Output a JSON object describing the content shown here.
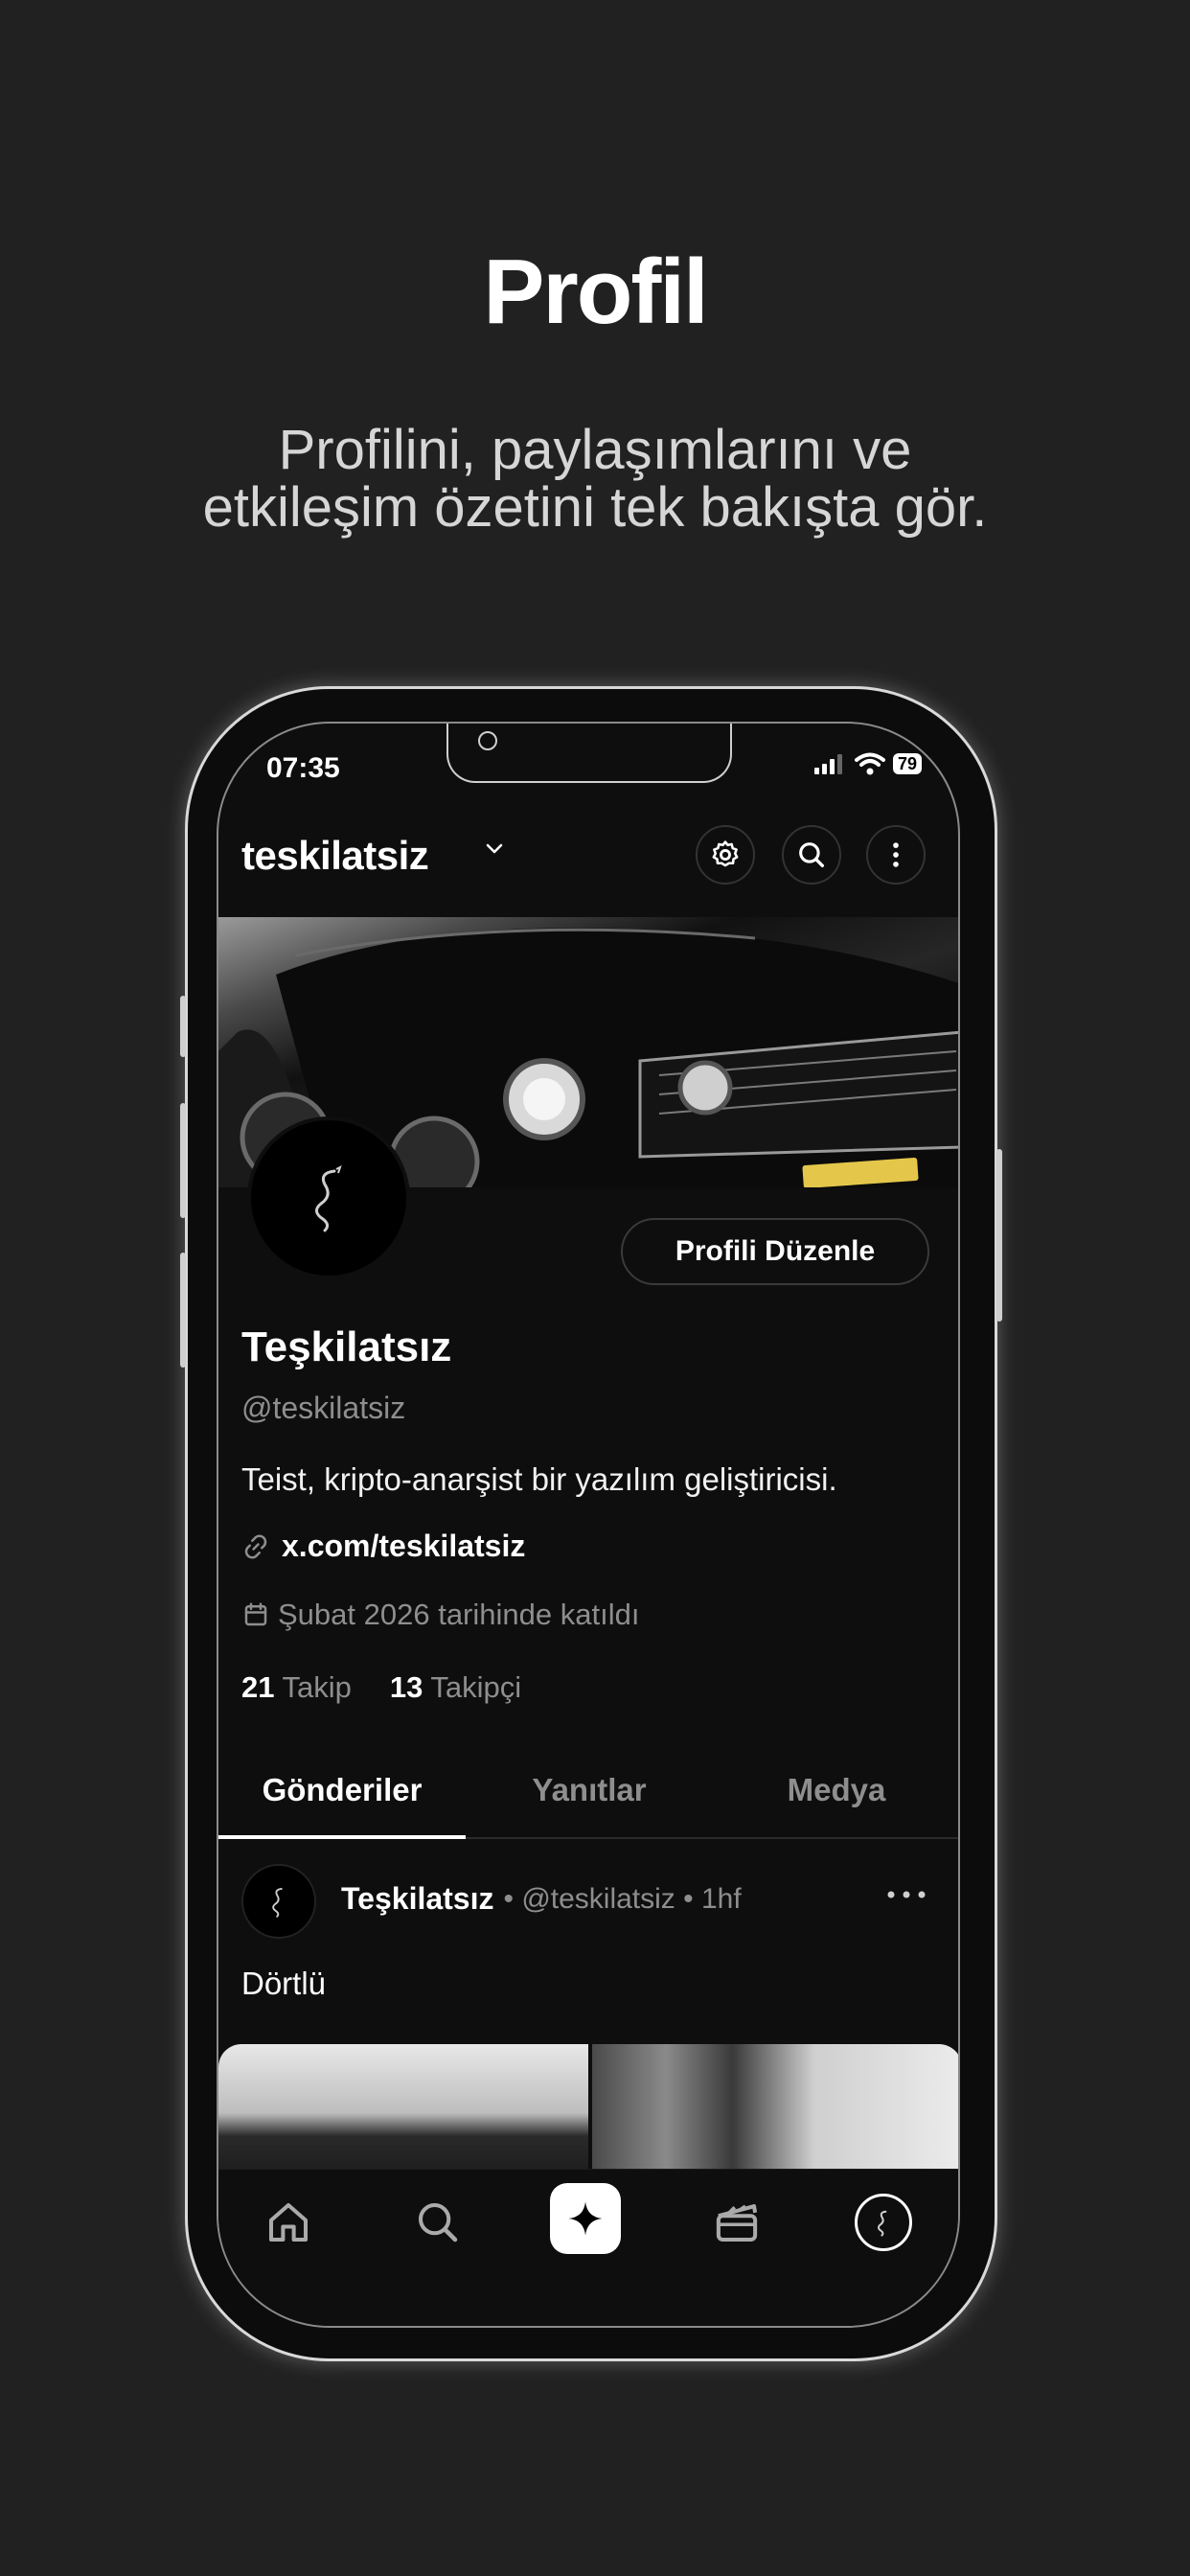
{
  "hero": {
    "title": "Profil",
    "subtitle_line1": "Profilini, paylaşımlarını ve",
    "subtitle_line2": "etkileşim özetini tek bakışta gör."
  },
  "status_bar": {
    "time": "07:35",
    "battery": "79"
  },
  "top_bar": {
    "username": "teskilatsiz",
    "icons": [
      "chevron-down-icon",
      "gear-icon",
      "search-icon",
      "more-vertical-icon"
    ]
  },
  "profile": {
    "edit_button": "Profili Düzenle",
    "display_name": "Teşkilatsız",
    "handle": "@teskilatsiz",
    "bio": "Teist, kripto-anarşist bir yazılım geliştiricisi.",
    "link": "x.com/teskilatsiz",
    "joined": "Şubat 2026 tarihinde katıldı",
    "following_count": "21",
    "following_label": "Takip",
    "followers_count": "13",
    "followers_label": "Takipçi"
  },
  "tabs": [
    {
      "label": "Gönderiler",
      "active": true
    },
    {
      "label": "Yanıtlar",
      "active": false
    },
    {
      "label": "Medya",
      "active": false
    }
  ],
  "post": {
    "author": "Teşkilatsız",
    "meta": "• @teskilatsiz • 1hf",
    "text": "Dörtlü"
  },
  "bottom_nav": [
    "home-icon",
    "search-icon",
    "sparkle-icon",
    "clapperboard-icon",
    "profile-avatar-icon"
  ],
  "colors": {
    "background": "#212121",
    "screen": "#0e0e0e",
    "muted_text": "#8e8e8e",
    "accent": "#ffffff"
  }
}
